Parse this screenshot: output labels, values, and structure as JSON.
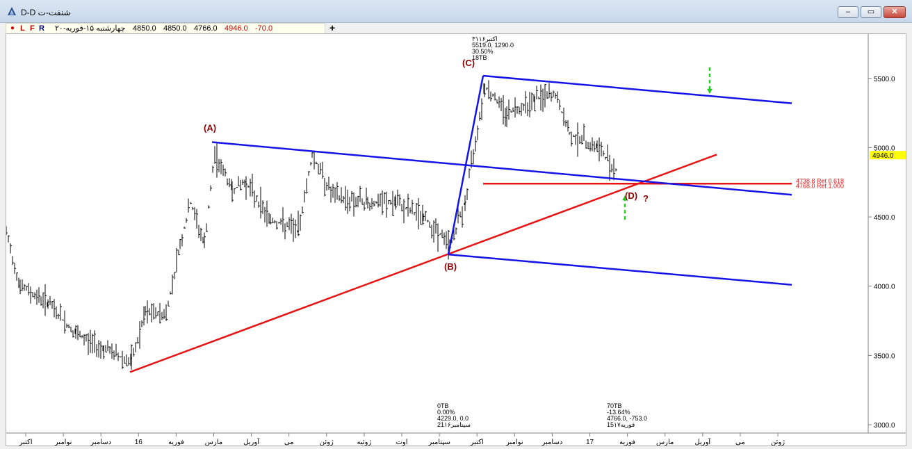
{
  "window": {
    "title": "D-D شنفت-ت",
    "minimize_label": "–",
    "maximize_label": "▭",
    "close_label": "✕"
  },
  "toolbar": {
    "flags": [
      "L",
      "F",
      "R"
    ],
    "date": "چهارشنبه ۱۵-فوریه-۲۰",
    "open": "4850.0",
    "high": "4850.0",
    "low": "4766.0",
    "close": "4946.0",
    "change": "-70.0",
    "add_label": "+"
  },
  "colors": {
    "channel": "#1414e6",
    "trend": "#e61414",
    "price": "#000000",
    "arrow": "#22cc22",
    "label": "#8b0000",
    "current_price_bg": "#ffff00"
  },
  "chart_data": {
    "type": "ohlc",
    "y_axis": {
      "ticks": [
        "3000.0",
        "3500.0",
        "4000.0",
        "4500.0",
        "5000.0",
        "5500.0"
      ],
      "ylim": [
        2940,
        5820
      ],
      "current_price": "4946.0"
    },
    "x_axis": {
      "labels": [
        "اکتبر",
        "نوامبر",
        "دسامبر",
        "16",
        "فوریه",
        "مارس",
        "آوریل",
        "می",
        "ژوئن",
        "ژوئیه",
        "اوت",
        "سپتامبر",
        "اکتبر",
        "نوامبر",
        "دسامبر",
        "17",
        "فوریه",
        "مارس",
        "آوریل",
        "می",
        "ژوئن"
      ]
    },
    "wave_labels": [
      {
        "label": "(A)",
        "price": 5050
      },
      {
        "label": "(B)",
        "price": 4229
      },
      {
        "label": "(C)",
        "price": 5519
      },
      {
        "label": "(D)",
        "price": 4700
      },
      {
        "label": "?",
        "price": 4690
      }
    ],
    "annotations": {
      "peak": [
        "۳۱اکتبر۱۶",
        "5519.0, 1290.0",
        "30.50%",
        "18TB"
      ],
      "trough": [
        "0TB",
        "0.00%",
        "4229.0, 0.0",
        "21سپتامبر۱۶"
      ],
      "last": [
        "70TB",
        "-13.64%",
        "4766.0, -753.0",
        "15فوریه۱۷"
      ]
    },
    "retracements": [
      "4738.8 Ret 0.618",
      "4768.0 Ret 1.000"
    ],
    "channel_lines": [
      {
        "from": [
          0,
          5040
        ],
        "to": [
          1,
          4660
        ]
      },
      {
        "from": [
          0,
          5520
        ],
        "to": [
          1,
          5320
        ]
      },
      {
        "from": [
          0,
          4229
        ],
        "to": [
          1,
          4010
        ]
      }
    ]
  }
}
